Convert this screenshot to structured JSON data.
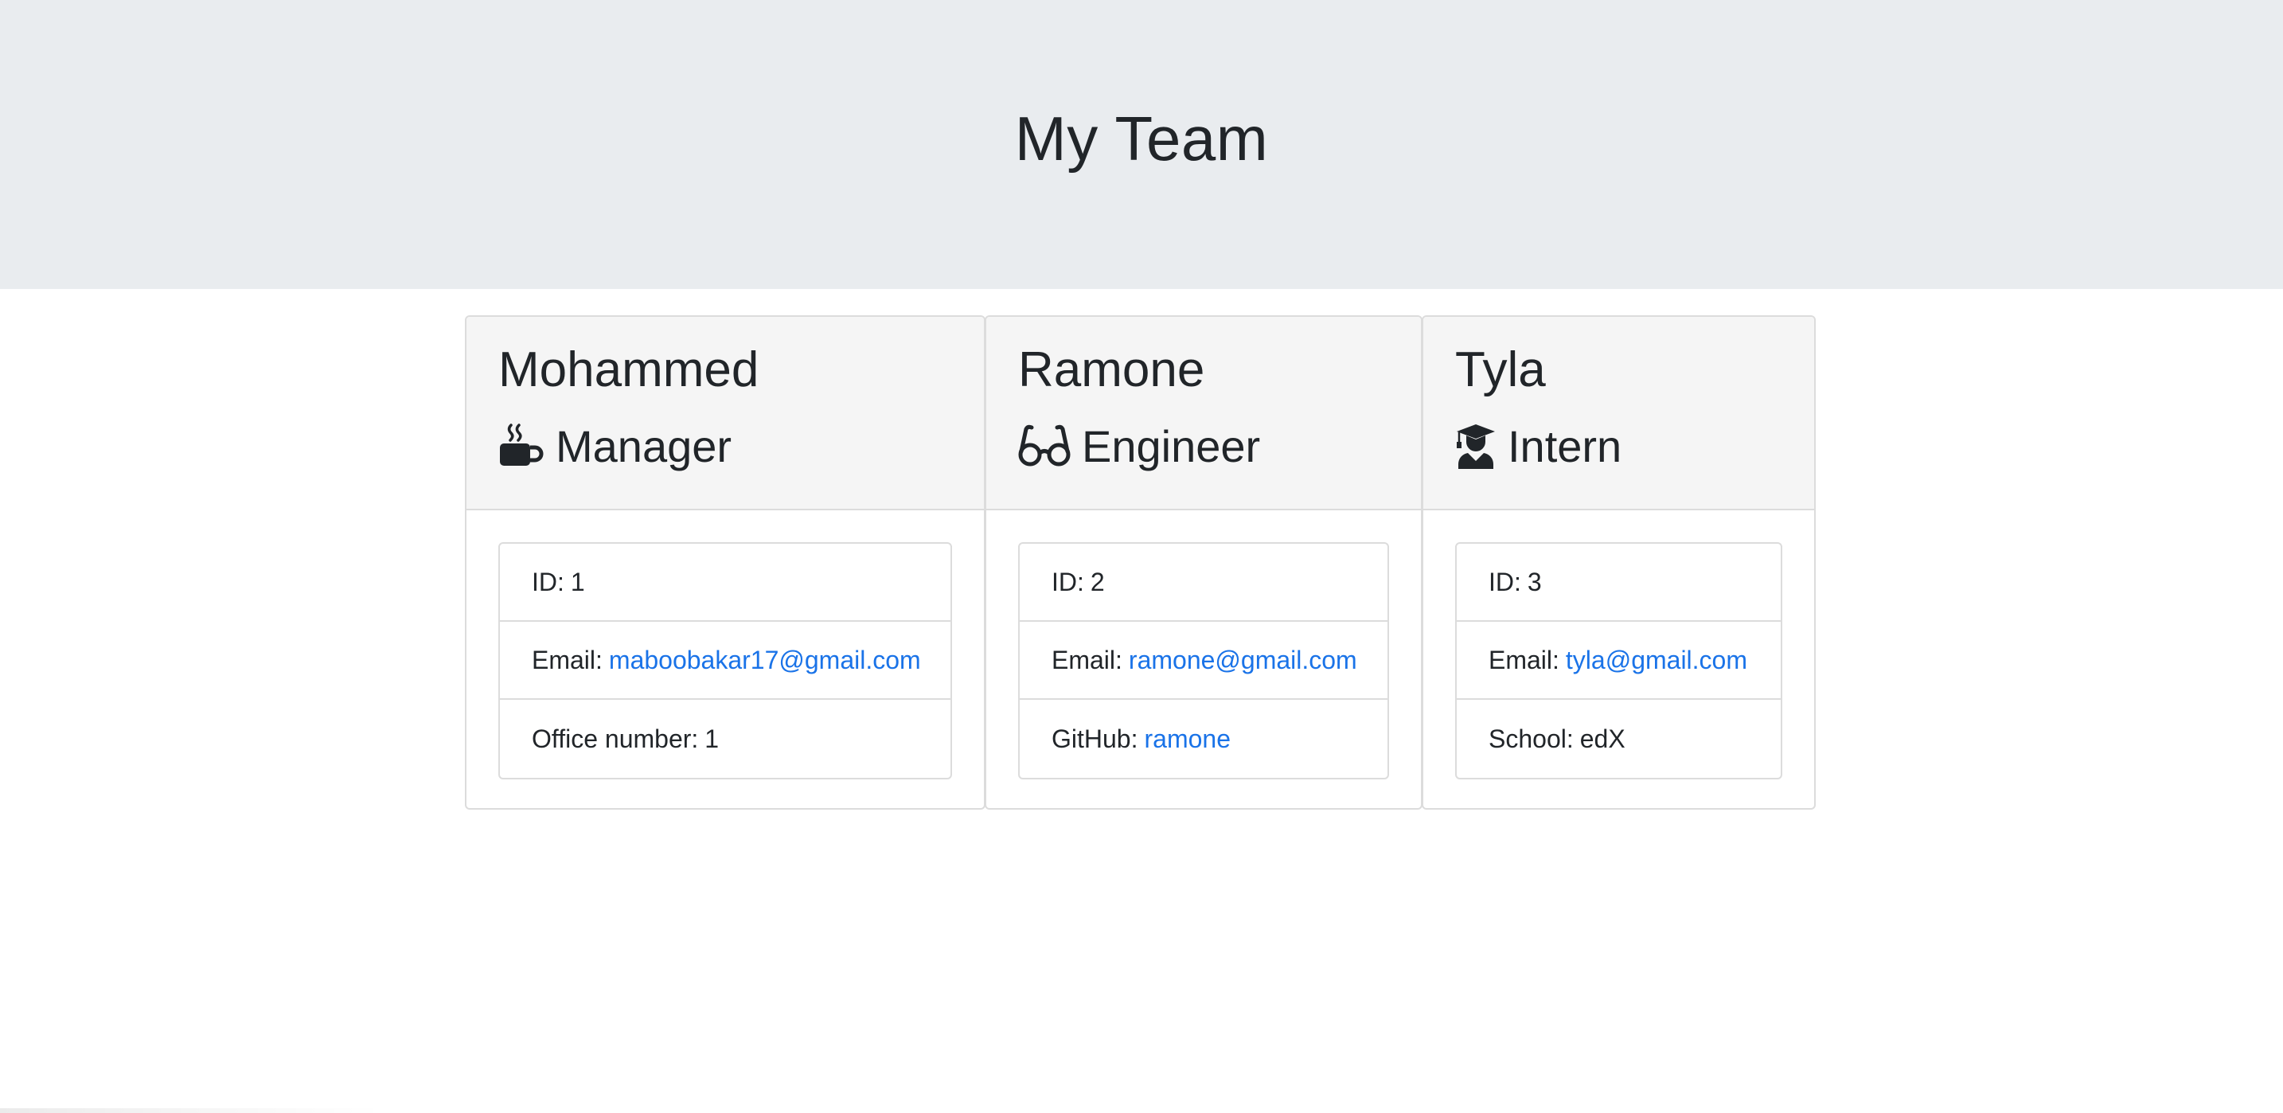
{
  "header": {
    "title": "My Team"
  },
  "team": [
    {
      "name": "Mohammed",
      "role": "Manager",
      "role_icon": "coffee-mug-icon",
      "id_label": "ID:",
      "id_value": "1",
      "email_label": "Email:",
      "email": "maboobakar17@gmail.com",
      "extra_label": "Office number:",
      "extra_value": "1"
    },
    {
      "name": "Ramone",
      "role": "Engineer",
      "role_icon": "glasses-icon",
      "id_label": "ID:",
      "id_value": "2",
      "email_label": "Email:",
      "email": "ramone@gmail.com",
      "extra_label": "GitHub:",
      "extra_value": "ramone"
    },
    {
      "name": "Tyla",
      "role": "Intern",
      "role_icon": "graduate-icon",
      "id_label": "ID:",
      "id_value": "3",
      "email_label": "Email:",
      "email": "tyla@gmail.com",
      "extra_label": "School:",
      "extra_value": "edX"
    }
  ],
  "colors": {
    "header_bg": "#e9ecef",
    "card_header_bg": "#f5f5f5",
    "link": "#1a73e8",
    "text": "#212529"
  }
}
